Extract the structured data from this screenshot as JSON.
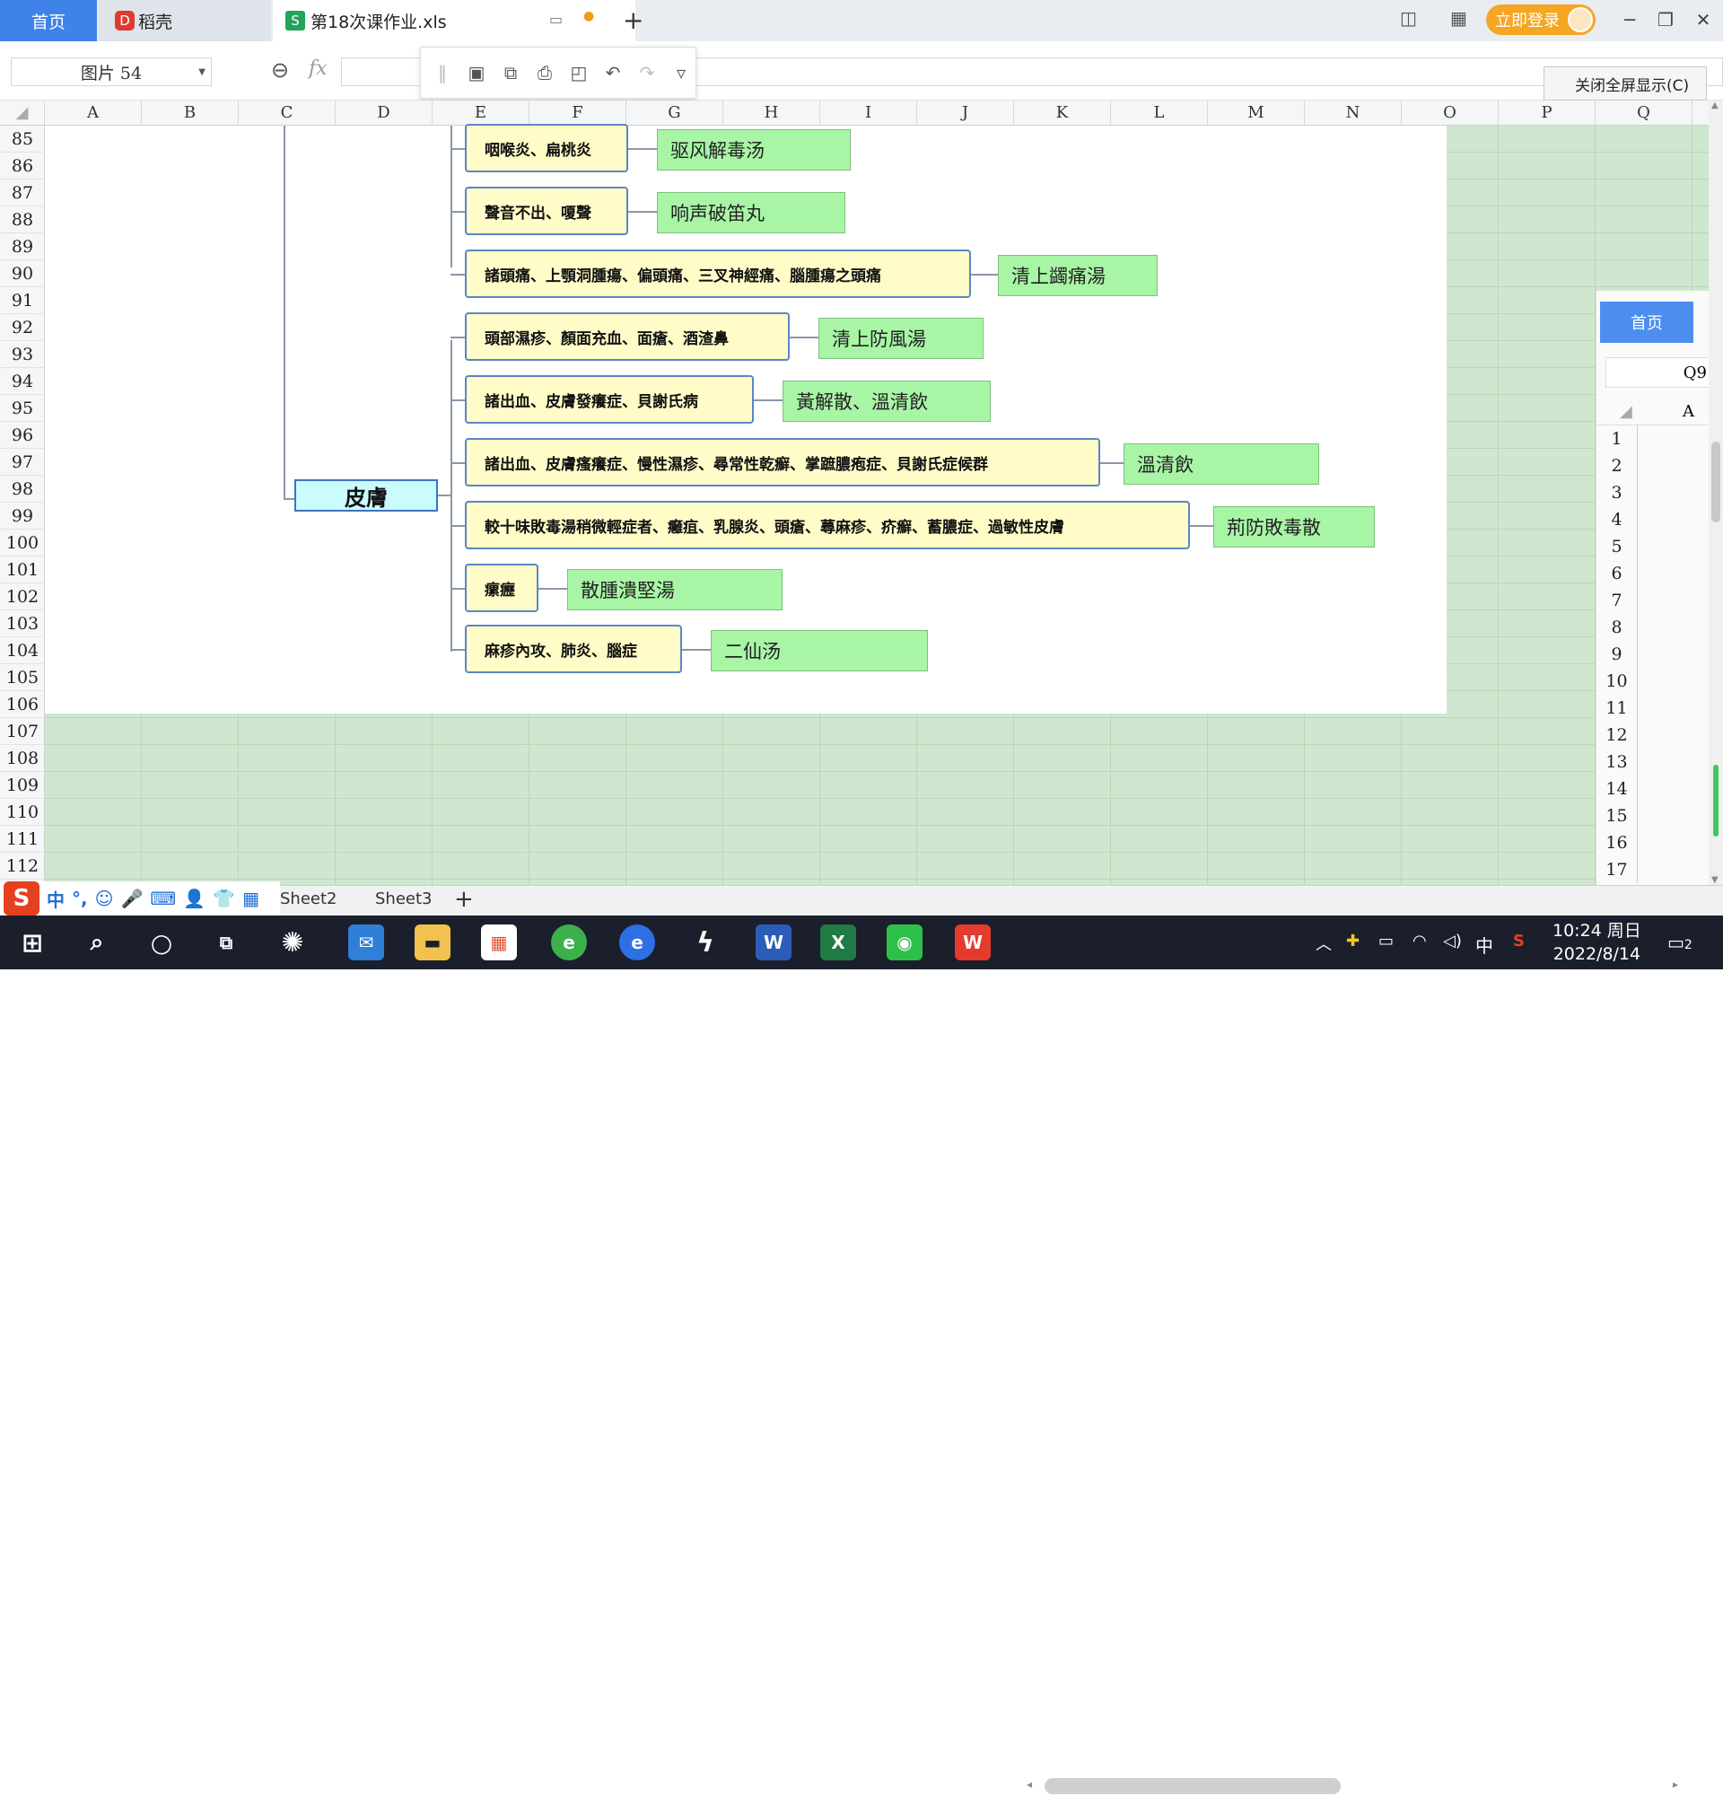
{
  "tabs": {
    "home": "首页",
    "daoke": "稻壳",
    "file": "第18次课作业.xls",
    "login": "立即登录"
  },
  "formula_bar": {
    "name_box": "图片 54",
    "fx": "fx",
    "exit_fullscreen": "关闭全屏显示(C)"
  },
  "columns": [
    "A",
    "B",
    "C",
    "D",
    "E",
    "F",
    "G",
    "H",
    "I",
    "J",
    "K",
    "L",
    "M",
    "N",
    "O",
    "P",
    "Q"
  ],
  "rows": [
    "85",
    "86",
    "87",
    "88",
    "89",
    "90",
    "91",
    "92",
    "93",
    "94",
    "95",
    "96",
    "97",
    "98",
    "99",
    "100",
    "101",
    "102",
    "103",
    "104",
    "105",
    "106",
    "107",
    "108",
    "109",
    "110",
    "111",
    "112"
  ],
  "mindmap": {
    "center": "皮膚",
    "branches": [
      {
        "symptom": "咽喉炎、扁桃炎",
        "formula": "驱风解毒汤"
      },
      {
        "symptom": "聲音不出、嗄聲",
        "formula": "响声破笛丸"
      },
      {
        "symptom": "諸頭痛、上顎洞腫瘍、偏頭痛、三叉神經痛、腦腫瘍之頭痛",
        "formula": "清上蠲痛湯"
      },
      {
        "symptom": "頭部濕疹、顏面充血、面瘡、酒渣鼻",
        "formula": "清上防風湯"
      },
      {
        "symptom": "諸出血、皮膚發癢症、貝謝氏病",
        "formula": "黃解散、溫清飲"
      },
      {
        "symptom": "諸出血、皮膚瘙癢症、慢性濕疹、尋常性乾癬、掌蹠膿疱症、貝謝氏症候群",
        "formula": "溫清飲"
      },
      {
        "symptom": "較十味敗毒湯稍微輕症者、癰疽、乳腺炎、頭瘡、蕁麻疹、疥癬、蓄膿症、過敏性皮膚",
        "formula": "荊防敗毒散"
      },
      {
        "symptom": "瘰癧",
        "formula": "散腫潰堅湯"
      },
      {
        "symptom": "麻疹內攻、肺炎、腦症",
        "formula": "二仙汤"
      }
    ]
  },
  "right_pane": {
    "home": "首页",
    "cell_ref": "Q9",
    "col": "A",
    "rows": [
      "1",
      "2",
      "3",
      "4",
      "5",
      "6",
      "7",
      "8",
      "9",
      "10",
      "11",
      "12",
      "13",
      "14",
      "15",
      "16",
      "17"
    ]
  },
  "sheets": [
    "Sheet2",
    "Sheet3"
  ],
  "ime": {
    "logo": "S",
    "mode": "中"
  },
  "taskbar": {
    "time": "10:24 周日",
    "date": "2022/8/14",
    "lang": "中",
    "notif": "2"
  }
}
